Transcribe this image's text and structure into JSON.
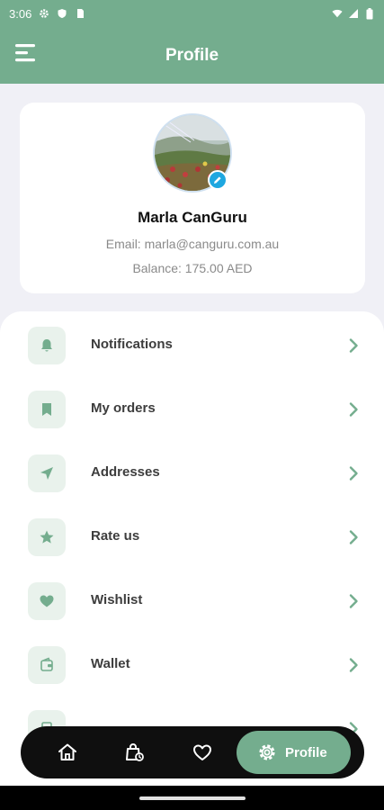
{
  "status_bar": {
    "time": "3:06"
  },
  "app_bar": {
    "title": "Profile"
  },
  "profile": {
    "name": "Marla CanGuru",
    "email": "Email: marla@canguru.com.au",
    "balance": "Balance: 175.00 AED"
  },
  "menu": {
    "items": [
      {
        "label": "Notifications",
        "icon": "bell-icon"
      },
      {
        "label": "My orders",
        "icon": "bookmark-icon"
      },
      {
        "label": "Addresses",
        "icon": "navigation-arrow-icon"
      },
      {
        "label": "Rate us",
        "icon": "star-icon"
      },
      {
        "label": "Wishlist",
        "icon": "heart-icon"
      },
      {
        "label": "Wallet",
        "icon": "wallet-icon"
      }
    ]
  },
  "bottom_nav": {
    "items": [
      "home-icon",
      "bag-icon",
      "heart-icon"
    ],
    "active_label": "Profile"
  },
  "colors": {
    "accent": "#74ad8e",
    "tile_bg": "#e9f2ec",
    "edit_badge": "#1ea7e0"
  }
}
